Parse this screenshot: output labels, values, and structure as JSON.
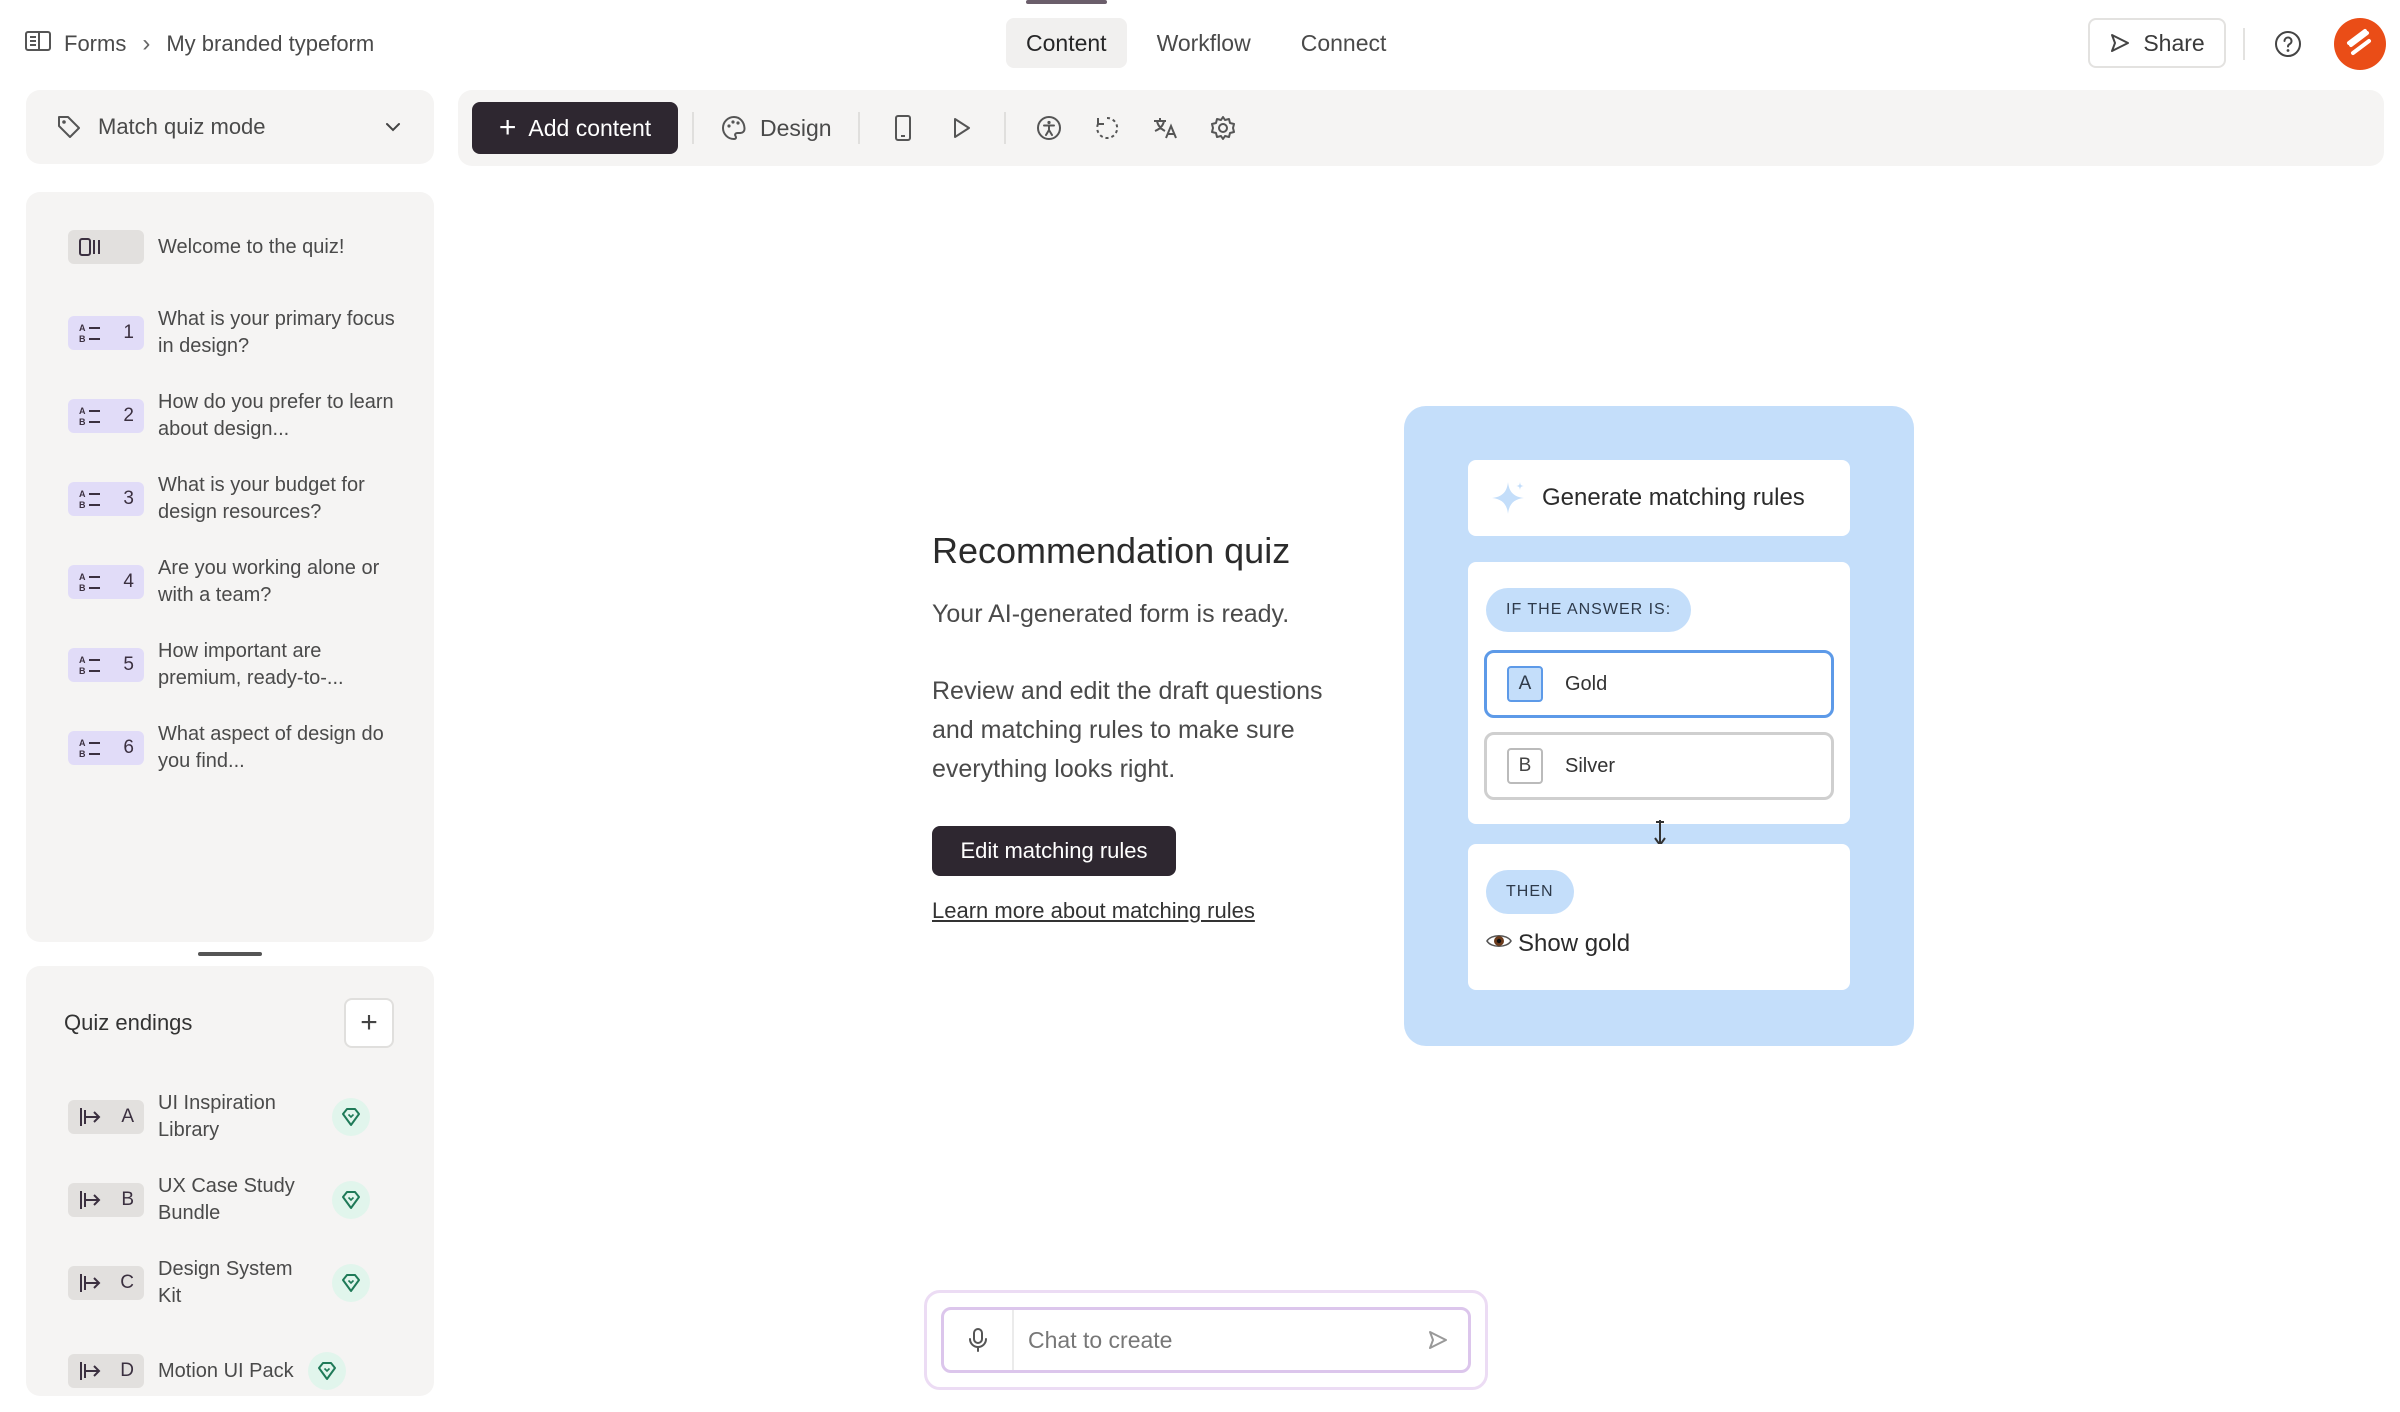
{
  "breadcrumb": {
    "root": "Forms",
    "current": "My branded typeform"
  },
  "tabs": [
    {
      "label": "Content"
    },
    {
      "label": "Workflow"
    },
    {
      "label": "Connect"
    }
  ],
  "header": {
    "share_label": "Share"
  },
  "mode": {
    "label": "Match quiz mode"
  },
  "toolbar": {
    "add_label": "Add content",
    "design_label": "Design"
  },
  "questions": [
    {
      "number": "",
      "text": "Welcome to the quiz!"
    },
    {
      "number": "1",
      "text": "What is your primary focus in design?"
    },
    {
      "number": "2",
      "text": "How do you prefer to learn about design..."
    },
    {
      "number": "3",
      "text": "What is your budget for design resources?"
    },
    {
      "number": "4",
      "text": "Are you working alone or with a team?"
    },
    {
      "number": "5",
      "text": "How important are premium, ready-to-..."
    },
    {
      "number": "6",
      "text": "What aspect of design do you find..."
    }
  ],
  "endings": {
    "title": "Quiz endings",
    "items": [
      {
        "letter": "A",
        "text": "UI Inspiration Library"
      },
      {
        "letter": "B",
        "text": "UX Case Study Bundle"
      },
      {
        "letter": "C",
        "text": "Design System Kit"
      },
      {
        "letter": "D",
        "text": "Motion UI Pack"
      }
    ]
  },
  "main": {
    "title": "Recommendation quiz",
    "subtitle": "Your AI-generated form is ready.",
    "body": "Review and edit the draft questions and matching rules to make sure everything looks right.",
    "edit_button": "Edit matching rules",
    "learn_link": "Learn more about matching rules"
  },
  "illustration": {
    "generate_label": "Generate matching rules",
    "if_label": "IF THE ANSWER IS:",
    "options": [
      {
        "key": "A",
        "label": "Gold"
      },
      {
        "key": "B",
        "label": "Silver"
      }
    ],
    "then_label": "THEN",
    "then_action": "Show gold"
  },
  "chat": {
    "placeholder": "Chat to create"
  },
  "colors": {
    "accent_dark": "#2e2730",
    "illus_bg": "#c4defa",
    "avatar": "#ea4d17",
    "mc_badge": "#e1dcf8"
  }
}
